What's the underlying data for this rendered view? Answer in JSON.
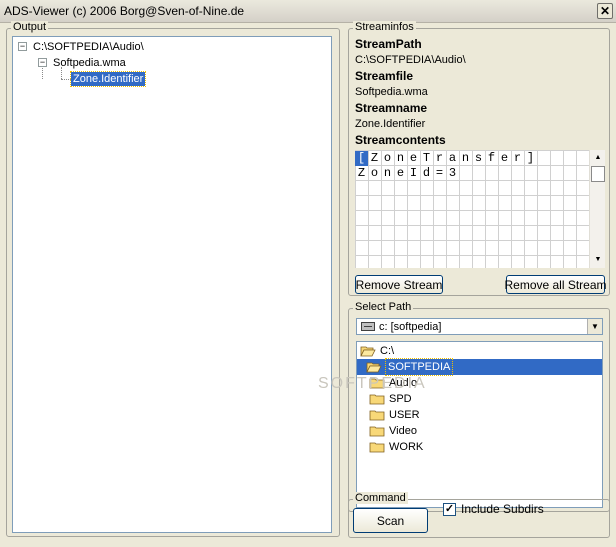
{
  "window": {
    "title": "ADS-Viewer (c) 2006 Borg@Sven-of-Nine.de",
    "close_glyph": "✕"
  },
  "output": {
    "legend": "Output",
    "tree": [
      {
        "label": "C:\\SOFTPEDIA\\Audio\\",
        "expander": "−"
      },
      {
        "label": "Softpedia.wma",
        "expander": "−"
      },
      {
        "label": "Zone.Identifier"
      }
    ]
  },
  "streaminfos": {
    "legend": "Streaminfos",
    "path_label": "StreamPath",
    "path_value": "C:\\SOFTPEDIA\\Audio\\",
    "file_label": "Streamfile",
    "file_value": "Softpedia.wma",
    "name_label": "Streamname",
    "name_value": "Zone.Identifier",
    "contents_label": "Streamcontents",
    "contents_rows": [
      [
        "[",
        "Z",
        "o",
        "n",
        "e",
        "T",
        "r",
        "a",
        "n",
        "s",
        "f",
        "e",
        "r",
        "]"
      ],
      [
        "Z",
        "o",
        "n",
        "e",
        "I",
        "d",
        "=",
        "3"
      ]
    ],
    "scroll_up": "▲",
    "scroll_down": "▼",
    "remove_stream": "Remove Stream",
    "remove_all_stream": "Remove all Stream"
  },
  "select_path": {
    "legend": "Select Path",
    "drive": "c: [softpedia]",
    "dropdown_glyph": "▼",
    "folders": [
      {
        "name": "C:\\",
        "selected": false,
        "open": true
      },
      {
        "name": "SOFTPEDIA",
        "selected": true,
        "open": true
      },
      {
        "name": "Audio",
        "selected": false,
        "open": false
      },
      {
        "name": "SPD",
        "selected": false,
        "open": false
      },
      {
        "name": "USER",
        "selected": false,
        "open": false
      },
      {
        "name": "Video",
        "selected": false,
        "open": false
      },
      {
        "name": "WORK",
        "selected": false,
        "open": false
      }
    ],
    "watermark": "SOFTPEDIA"
  },
  "command": {
    "legend": "Command",
    "scan": "Scan",
    "include_subdirs": "Include Subdirs",
    "include_checked": true,
    "check_glyph": "✓"
  },
  "colors": {
    "selection": "#316ac5",
    "background": "#ece9d8",
    "folder": "#f8d878"
  }
}
